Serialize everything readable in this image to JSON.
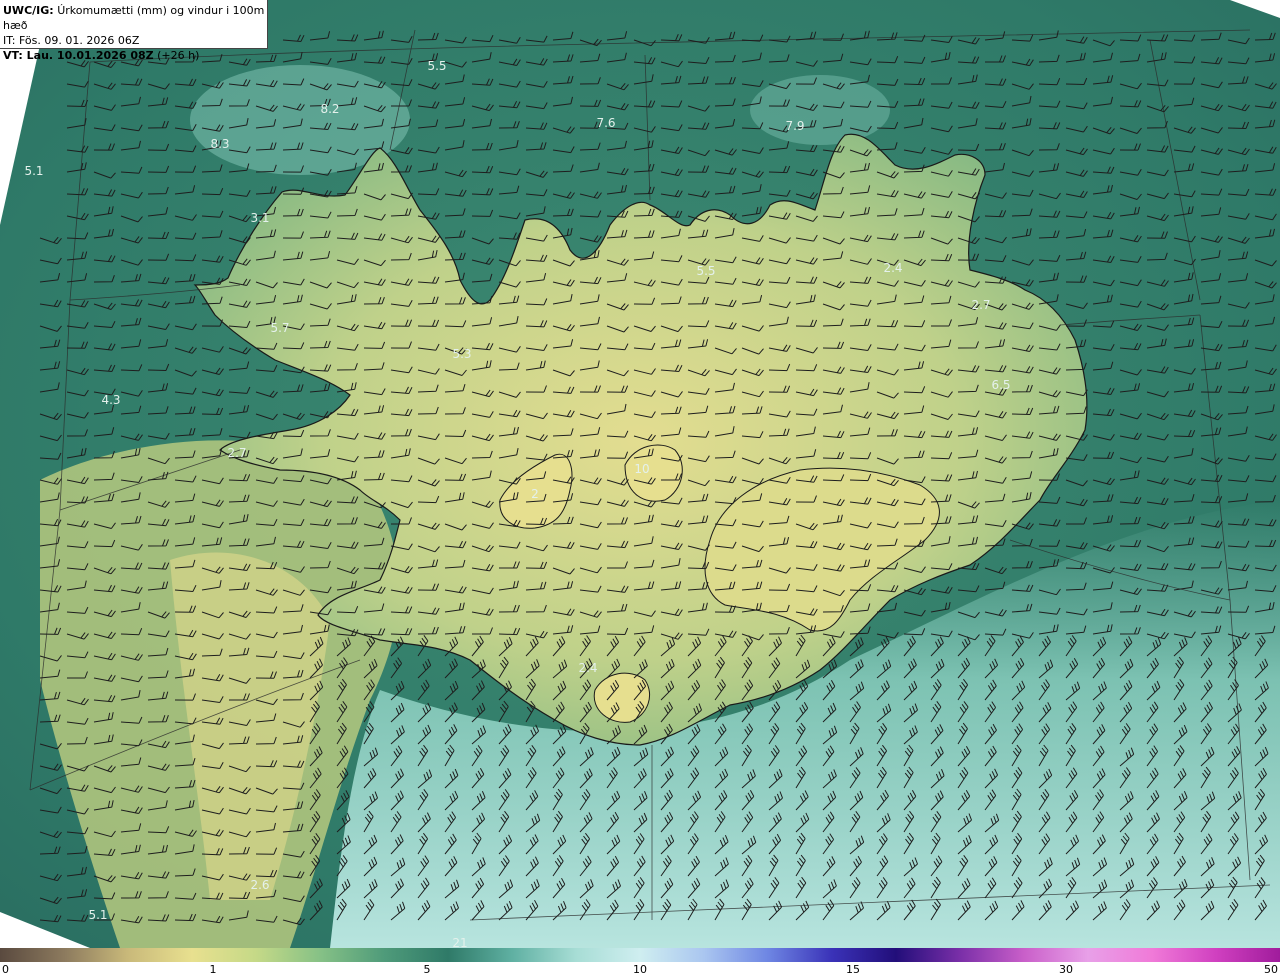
{
  "header": {
    "model": "UWC/IG:",
    "title": "Úrkomumætti (mm) og vindur i 100m hæð",
    "initial_time": "IT: Fös. 09. 01. 2026 06Z",
    "valid_prefix": "VT: Lau. 10.01.2026 08Z",
    "valid_suffix": "(+26 h)"
  },
  "map": {
    "region": "Iceland",
    "value_labels": [
      "5.5",
      "8.2",
      "7.6",
      "7.9",
      "8.3",
      "5.1",
      "3.1",
      "5.5",
      "2.4",
      "2.7",
      "5.7",
      "5.3",
      "6.5",
      "4.3",
      "2.7",
      "10",
      "2",
      "2.4",
      "2.6",
      "5.1",
      "21"
    ]
  },
  "colorbar": {
    "ticks": [
      "0",
      "1",
      "5",
      "10",
      "15",
      "30",
      "50"
    ],
    "colors": [
      "#5a4a3f",
      "#8c7a5e",
      "#c9b97a",
      "#e8e08f",
      "#c5d987",
      "#86c186",
      "#4f9b7a",
      "#2f7a68",
      "#5fb0a2",
      "#a7ddd5",
      "#cfeef0",
      "#aac6f0",
      "#6e86e3",
      "#3a32b8",
      "#220e7a",
      "#7a2fa8",
      "#c95fc9",
      "#e8a0e8",
      "#f07ad8",
      "#d040c0",
      "#a01c9c"
    ]
  }
}
